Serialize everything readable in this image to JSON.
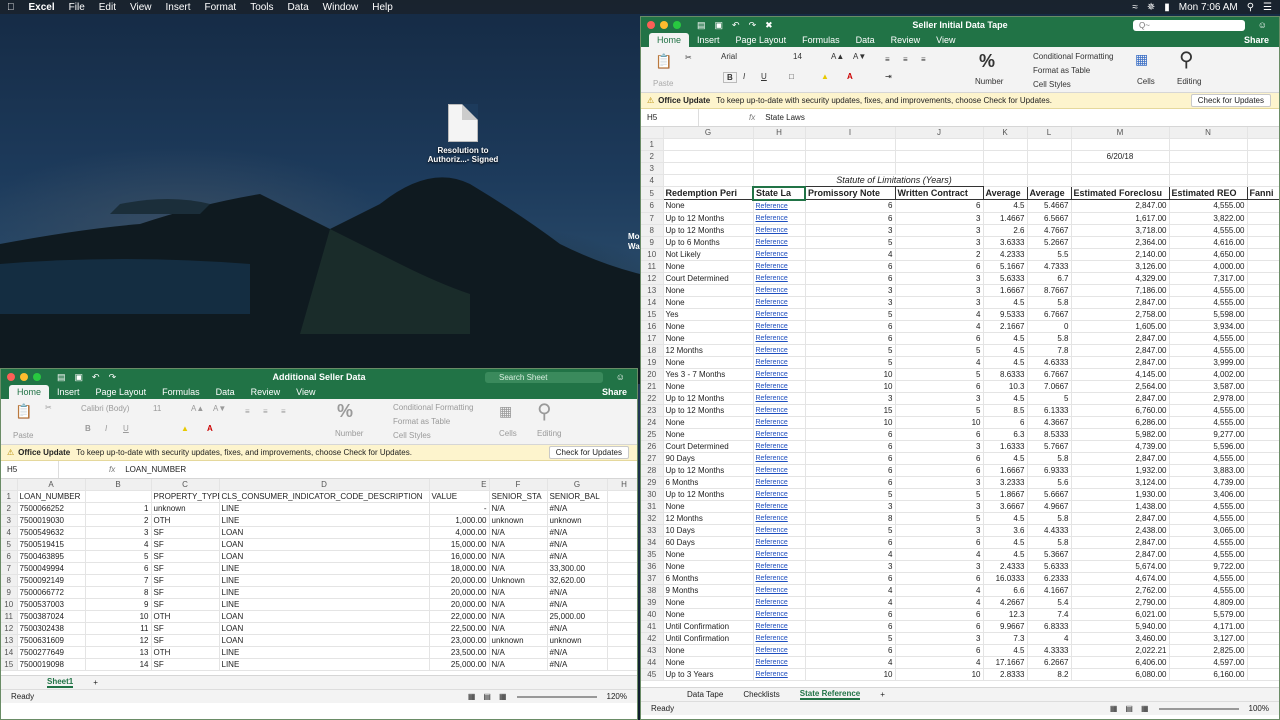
{
  "menubar": {
    "app_name": "Excel",
    "items": [
      "File",
      "Edit",
      "View",
      "Insert",
      "Format",
      "Tools",
      "Data",
      "Window",
      "Help"
    ],
    "clock": "Mon 7:06 AM"
  },
  "desktop": {
    "file_label_1": "Resolution to",
    "file_label_2": "Authoriz...- Signed",
    "side_text": "Mo Wa"
  },
  "right_window": {
    "title": "Seller Initial Data Tape",
    "search_placeholder": "Q~",
    "tabs": [
      "Home",
      "Insert",
      "Page Layout",
      "Formulas",
      "Data",
      "Review",
      "View"
    ],
    "share": "Share",
    "font_name": "Arial",
    "font_size": "14",
    "ribbon": {
      "number": "Number",
      "conditional": "Conditional Formatting",
      "format_table": "Format as Table",
      "cell_styles": "Cell Styles",
      "cells": "Cells",
      "editing": "Editing",
      "paste": "Paste"
    },
    "notice": {
      "title": "Office Update",
      "text": "To keep up-to-date with security updates, fixes, and improvements, choose Check for Updates.",
      "button": "Check for Updates"
    },
    "cell_ref": "H5",
    "formula": "State Laws",
    "columns": [
      "G",
      "H",
      "I",
      "J",
      "K",
      "L",
      "M",
      "N"
    ],
    "date": "6/20/18",
    "statute_header": "Statute of Limitations (Years)",
    "headers": [
      "Redemption Peri",
      "State La",
      "Promissory Note",
      "Written Contract",
      "Average",
      "Average",
      "Estimated Foreclosu",
      "Estimated REO",
      "Fanni"
    ],
    "link_text": "Reference",
    "rows": [
      [
        "6",
        "None",
        "",
        "6",
        "6",
        "4.5",
        "5.4667",
        "2,847.00",
        "4,555.00"
      ],
      [
        "7",
        "Up to 12 Months",
        "",
        "6",
        "3",
        "1.4667",
        "6.5667",
        "1,617.00",
        "3,822.00"
      ],
      [
        "8",
        "Up to 12 Months",
        "",
        "3",
        "3",
        "2.6",
        "4.7667",
        "3,718.00",
        "4,555.00"
      ],
      [
        "9",
        "Up to 6 Months",
        "",
        "5",
        "3",
        "3.6333",
        "5.2667",
        "2,364.00",
        "4,616.00"
      ],
      [
        "10",
        "Not Likely",
        "",
        "4",
        "2",
        "4.2333",
        "5.5",
        "2,140.00",
        "4,650.00"
      ],
      [
        "11",
        "None",
        "",
        "6",
        "6",
        "5.1667",
        "4.7333",
        "3,126.00",
        "4,000.00"
      ],
      [
        "12",
        "Court Determined",
        "",
        "6",
        "3",
        "5.6333",
        "6.7",
        "4,329.00",
        "7,317.00"
      ],
      [
        "13",
        "None",
        "",
        "3",
        "3",
        "1.6667",
        "8.7667",
        "7,186.00",
        "4,555.00"
      ],
      [
        "14",
        "None",
        "",
        "3",
        "3",
        "4.5",
        "5.8",
        "2,847.00",
        "4,555.00"
      ],
      [
        "15",
        "Yes",
        "",
        "5",
        "4",
        "9.5333",
        "6.7667",
        "2,758.00",
        "5,598.00"
      ],
      [
        "16",
        "None",
        "",
        "6",
        "4",
        "2.1667",
        "0",
        "1,605.00",
        "3,934.00"
      ],
      [
        "17",
        "None",
        "",
        "6",
        "6",
        "4.5",
        "5.8",
        "2,847.00",
        "4,555.00"
      ],
      [
        "18",
        "12 Months",
        "",
        "5",
        "5",
        "4.5",
        "7.8",
        "2,847.00",
        "4,555.00"
      ],
      [
        "19",
        "None",
        "",
        "5",
        "4",
        "4.5",
        "4.6333",
        "2,847.00",
        "3,999.00"
      ],
      [
        "20",
        "Yes 3 - 7 Months",
        "",
        "10",
        "5",
        "8.6333",
        "6.7667",
        "4,145.00",
        "4,002.00"
      ],
      [
        "21",
        "None",
        "",
        "10",
        "6",
        "10.3",
        "7.0667",
        "2,564.00",
        "3,587.00"
      ],
      [
        "22",
        "Up to 12 Months",
        "",
        "3",
        "3",
        "4.5",
        "5",
        "2,847.00",
        "2,978.00"
      ],
      [
        "23",
        "Up to 12 Months",
        "",
        "15",
        "5",
        "8.5",
        "6.1333",
        "6,760.00",
        "4,555.00"
      ],
      [
        "24",
        "None",
        "",
        "10",
        "10",
        "6",
        "4.3667",
        "6,286.00",
        "4,555.00"
      ],
      [
        "25",
        "None",
        "",
        "6",
        "6",
        "6.3",
        "8.5333",
        "5,982.00",
        "9,277.00"
      ],
      [
        "26",
        "Court Determined",
        "",
        "6",
        "3",
        "1.6333",
        "5.7667",
        "4,739.00",
        "5,596.00"
      ],
      [
        "27",
        "90 Days",
        "",
        "6",
        "6",
        "4.5",
        "5.8",
        "2,847.00",
        "4,555.00"
      ],
      [
        "28",
        "Up to 12 Months",
        "",
        "6",
        "6",
        "1.6667",
        "6.9333",
        "1,932.00",
        "3,883.00"
      ],
      [
        "29",
        "6 Months",
        "",
        "6",
        "3",
        "3.2333",
        "5.6",
        "3,124.00",
        "4,739.00"
      ],
      [
        "30",
        "Up to 12 Months",
        "",
        "5",
        "5",
        "1.8667",
        "5.6667",
        "1,930.00",
        "3,406.00"
      ],
      [
        "31",
        "None",
        "",
        "3",
        "3",
        "3.6667",
        "4.9667",
        "1,438.00",
        "4,555.00"
      ],
      [
        "32",
        "12 Months",
        "",
        "8",
        "5",
        "4.5",
        "5.8",
        "2,847.00",
        "4,555.00"
      ],
      [
        "33",
        "10 Days",
        "",
        "5",
        "3",
        "3.6",
        "4.4333",
        "2,438.00",
        "3,065.00"
      ],
      [
        "34",
        "60 Days",
        "",
        "6",
        "6",
        "4.5",
        "5.8",
        "2,847.00",
        "4,555.00"
      ],
      [
        "35",
        "None",
        "",
        "4",
        "4",
        "4.5",
        "5.3667",
        "2,847.00",
        "4,555.00"
      ],
      [
        "36",
        "None",
        "",
        "3",
        "3",
        "2.4333",
        "5.6333",
        "5,674.00",
        "9,722.00"
      ],
      [
        "37",
        "6 Months",
        "",
        "6",
        "6",
        "16.0333",
        "6.2333",
        "4,674.00",
        "4,555.00"
      ],
      [
        "38",
        "9 Months",
        "",
        "4",
        "4",
        "6.6",
        "4.1667",
        "2,762.00",
        "4,555.00"
      ],
      [
        "39",
        "None",
        "",
        "4",
        "4",
        "4.2667",
        "5.4",
        "2,790.00",
        "4,809.00"
      ],
      [
        "40",
        "None",
        "",
        "6",
        "6",
        "12.3",
        "7.4",
        "6,021.00",
        "5,579.00"
      ],
      [
        "41",
        "Until Confirmation",
        "",
        "6",
        "6",
        "9.9667",
        "6.8333",
        "5,940.00",
        "4,171.00"
      ],
      [
        "42",
        "Until Confirmation",
        "",
        "5",
        "3",
        "7.3",
        "4",
        "3,460.00",
        "3,127.00"
      ],
      [
        "43",
        "None",
        "",
        "6",
        "6",
        "4.5",
        "4.3333",
        "2,022.21",
        "2,825.00"
      ],
      [
        "44",
        "None",
        "",
        "4",
        "4",
        "17.1667",
        "6.2667",
        "6,406.00",
        "4,597.00"
      ],
      [
        "45",
        "Up to 3 Years",
        "",
        "10",
        "10",
        "2.8333",
        "8.2",
        "6,080.00",
        "6,160.00"
      ]
    ],
    "sheet_tabs": [
      "Data Tape",
      "Checklists",
      "State Reference"
    ],
    "active_sheet": "State Reference",
    "status": "Ready",
    "zoom": "100%"
  },
  "left_window": {
    "title": "Additional Seller Data",
    "search_placeholder": "Search Sheet",
    "tabs": [
      "Home",
      "Insert",
      "Page Layout",
      "Formulas",
      "Data",
      "Review",
      "View"
    ],
    "share": "Share",
    "font_name": "Calibri (Body)",
    "font_size": "11",
    "ribbon": {
      "number": "Number",
      "conditional": "Conditional Formatting",
      "format_table": "Format as Table",
      "cell_styles": "Cell Styles",
      "cells": "Cells",
      "editing": "Editing",
      "paste": "Paste"
    },
    "notice": {
      "title": "Office Update",
      "text": "To keep up-to-date with security updates, fixes, and improvements, choose Check for Updates.",
      "button": "Check for Updates"
    },
    "cell_ref": "H5",
    "formula": "LOAN_NUMBER",
    "columns": [
      "A",
      "B",
      "C",
      "D",
      "E",
      "F",
      "G",
      "H"
    ],
    "headers": [
      "LOAN_NUMBER",
      "PROPERTY_TYPE",
      "CLS_CONSUMER_INDICATOR_CODE_DESCRIPTION",
      "VALUE",
      "SENIOR_STA",
      "SENIOR_BAL"
    ],
    "rows": [
      [
        "2",
        "7500066252",
        "1",
        "unknown",
        "LINE",
        "-",
        "N/A",
        "#N/A"
      ],
      [
        "3",
        "7500019030",
        "2",
        "OTH",
        "LINE",
        "1,000.00",
        "unknown",
        "unknown"
      ],
      [
        "4",
        "7500549632",
        "3",
        "SF",
        "LOAN",
        "4,000.00",
        "N/A",
        "#N/A"
      ],
      [
        "5",
        "7500519415",
        "4",
        "SF",
        "LOAN",
        "15,000.00",
        "N/A",
        "#N/A"
      ],
      [
        "6",
        "7500463895",
        "5",
        "SF",
        "LOAN",
        "16,000.00",
        "N/A",
        "#N/A"
      ],
      [
        "7",
        "7500049994",
        "6",
        "SF",
        "LINE",
        "18,000.00",
        "N/A",
        "33,300.00"
      ],
      [
        "8",
        "7500092149",
        "7",
        "SF",
        "LINE",
        "20,000.00",
        "Unknown",
        "32,620.00"
      ],
      [
        "9",
        "7500066772",
        "8",
        "SF",
        "LINE",
        "20,000.00",
        "N/A",
        "#N/A"
      ],
      [
        "10",
        "7500537003",
        "9",
        "SF",
        "LINE",
        "20,000.00",
        "N/A",
        "#N/A"
      ],
      [
        "11",
        "7500387024",
        "10",
        "OTH",
        "LOAN",
        "22,000.00",
        "N/A",
        "25,000.00"
      ],
      [
        "12",
        "7500302438",
        "11",
        "SF",
        "LOAN",
        "22,500.00",
        "N/A",
        "#N/A"
      ],
      [
        "13",
        "7500631609",
        "12",
        "SF",
        "LOAN",
        "23,000.00",
        "unknown",
        "unknown"
      ],
      [
        "14",
        "7500277649",
        "13",
        "OTH",
        "LINE",
        "23,500.00",
        "N/A",
        "#N/A"
      ],
      [
        "15",
        "7500019098",
        "14",
        "SF",
        "LINE",
        "25,000.00",
        "N/A",
        "#N/A"
      ]
    ],
    "sheet_tabs": [
      "Sheet1"
    ],
    "active_sheet": "Sheet1",
    "status": "Ready",
    "zoom": "120%"
  }
}
